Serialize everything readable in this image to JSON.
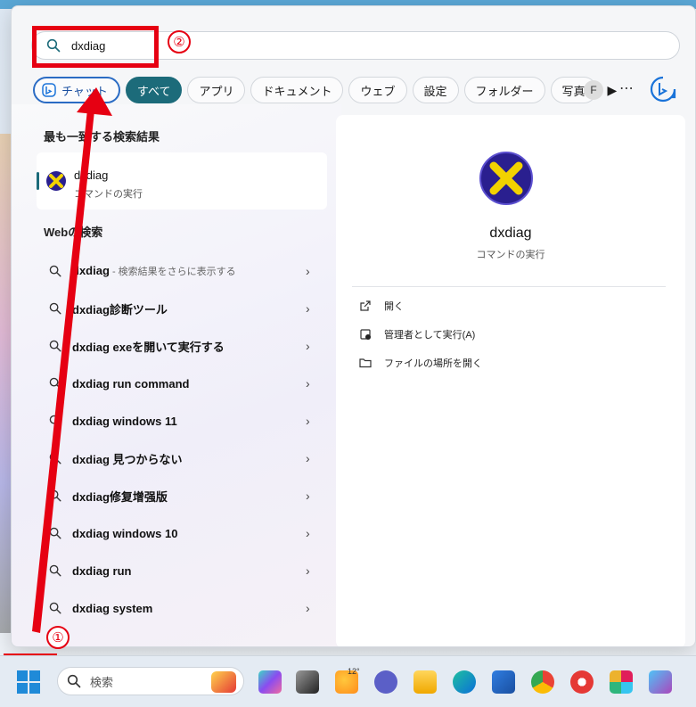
{
  "search": {
    "query": "dxdiag"
  },
  "filters": {
    "chat_label": "チャット",
    "items": [
      "すべて",
      "アプリ",
      "ドキュメント",
      "ウェブ",
      "設定",
      "フォルダー",
      "写真"
    ],
    "more_arrow": "▶",
    "account_initial": "F",
    "ellipsis": "⋯"
  },
  "best_match": {
    "title": "最も一致する検索結果",
    "name": "dxdiag",
    "subtitle": "コマンドの実行"
  },
  "web_search": {
    "title": "Webの検索",
    "items": [
      {
        "bold": "dxdiag",
        "rest": "",
        "hint": " - 検索結果をさらに表示する"
      },
      {
        "bold": "dxdiag診断ツール",
        "rest": "",
        "hint": ""
      },
      {
        "bold": "dxdiag exeを開いて実行する",
        "rest": "",
        "hint": ""
      },
      {
        "bold": "dxdiag run command",
        "rest": "",
        "hint": ""
      },
      {
        "bold": "dxdiag windows 11",
        "rest": "",
        "hint": ""
      },
      {
        "bold": "dxdiag 見つからない",
        "rest": "",
        "hint": ""
      },
      {
        "bold": "dxdiag修复增强版",
        "rest": "",
        "hint": ""
      },
      {
        "bold": "dxdiag windows 10",
        "rest": "",
        "hint": ""
      },
      {
        "bold": "dxdiag run",
        "rest": "",
        "hint": ""
      },
      {
        "bold": "dxdiag system",
        "rest": "",
        "hint": ""
      }
    ]
  },
  "detail": {
    "name": "dxdiag",
    "subtitle": "コマンドの実行",
    "actions": [
      "開く",
      "管理者として実行(A)",
      "ファイルの場所を開く"
    ]
  },
  "annotations": {
    "step1": "①",
    "step2": "②"
  },
  "taskbar": {
    "search_placeholder": "検索",
    "weather_temp": "12°",
    "icons": [
      "copilot-icon",
      "task-view-icon",
      "weather-icon",
      "teams-icon",
      "file-explorer-icon",
      "edge-icon",
      "store-icon",
      "chrome-icon",
      "app-icon",
      "slack-icon",
      "paint-icon"
    ]
  },
  "colors": {
    "annotation_red": "#e60012",
    "accent": "#1c6b7a"
  }
}
